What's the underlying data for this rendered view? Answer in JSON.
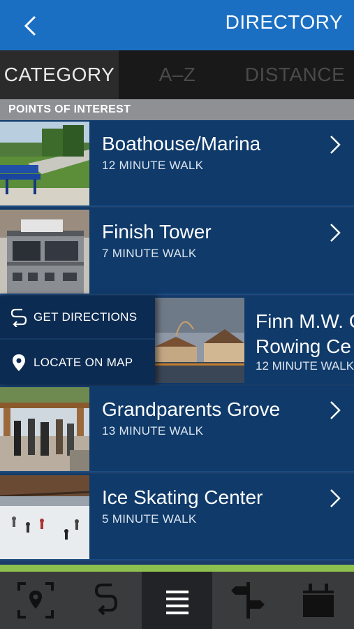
{
  "header": {
    "title": "DIRECTORY",
    "back_icon": "chevron-left-icon"
  },
  "tabs": [
    {
      "label": "CATEGORY",
      "active": true
    },
    {
      "label": "A–Z",
      "active": false
    },
    {
      "label": "DISTANCE",
      "active": false
    }
  ],
  "section": {
    "title": "POINTS OF INTEREST"
  },
  "items": [
    {
      "name": "Boathouse/Marina",
      "walk": "12 MINUTE WALK"
    },
    {
      "name": "Finish Tower",
      "walk": "7 MINUTE WALK"
    },
    {
      "name_line1": "Finn M.W. C",
      "name_line2": "Rowing Ce",
      "walk": "12 MINUTE WALK"
    },
    {
      "name": "Grandparents Grove",
      "walk": "13 MINUTE WALK"
    },
    {
      "name": "Ice Skating Center",
      "walk": "5 MINUTE WALK"
    }
  ],
  "swipe_actions": {
    "directions_label": "GET DIRECTIONS",
    "locate_label": "LOCATE ON MAP"
  },
  "bottom_nav": [
    {
      "icon": "map-pin-frame-icon",
      "active": false
    },
    {
      "icon": "route-icon",
      "active": false
    },
    {
      "icon": "list-icon",
      "active": true
    },
    {
      "icon": "signpost-icon",
      "active": false
    },
    {
      "icon": "calendar-icon",
      "active": false
    }
  ],
  "colors": {
    "header": "#1a6fc3",
    "row": "#0f3a6a",
    "accent_bar": "#8cc04f",
    "nav": "#3a3b3d"
  }
}
